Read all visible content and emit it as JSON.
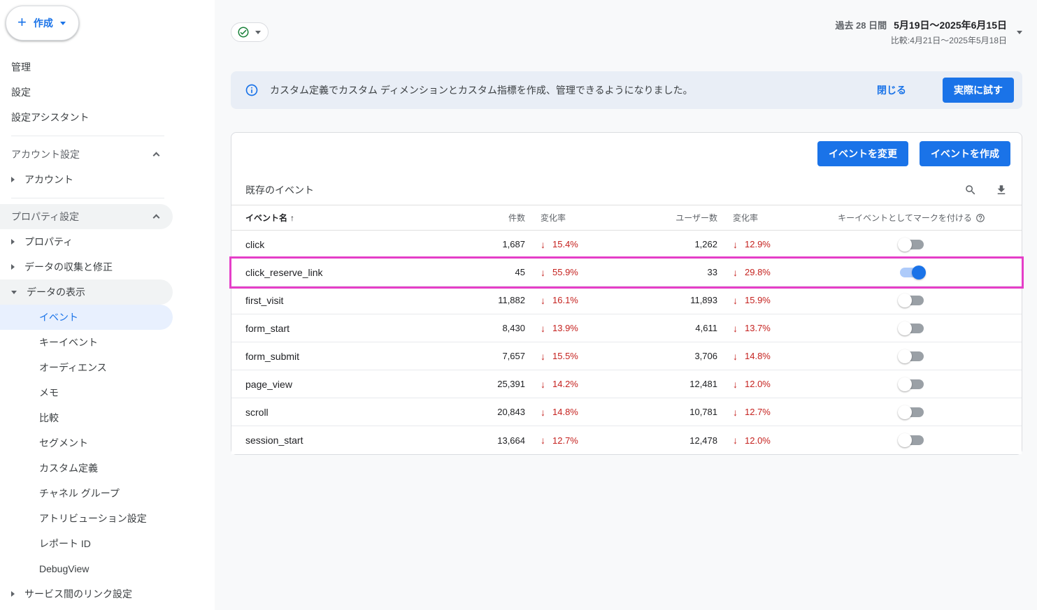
{
  "sidebar": {
    "create_button_label": "作成",
    "admin_label": "管理",
    "settings_label": "設定",
    "setup_assistant_label": "設定アシスタント",
    "account_settings_header": "アカウント設定",
    "account_label": "アカウント",
    "property_settings_header": "プロパティ設定",
    "property_label": "プロパティ",
    "data_collection_label": "データの収集と修正",
    "data_display_label": "データの表示",
    "data_display_children": [
      "イベント",
      "キーイベント",
      "オーディエンス",
      "メモ",
      "比較",
      "セグメント",
      "カスタム定義",
      "チャネル グループ",
      "アトリビューション設定",
      "レポート ID",
      "DebugView"
    ],
    "cross_service_label": "サービス間のリンク設定"
  },
  "topbar": {
    "period_label": "過去 28 日間",
    "date_range": "5月19日〜2025年6月15日",
    "comparison": "比較:4月21日〜2025年5月18日"
  },
  "banner": {
    "message": "カスタム定義でカスタム ディメンションとカスタム指標を作成、管理できるようになりました。",
    "close_label": "閉じる",
    "cta_label": "実際に試す"
  },
  "events_panel": {
    "modify_button_label": "イベントを変更",
    "create_button_label": "イベントを作成",
    "list_title": "既存のイベント",
    "columns": {
      "name": "イベント名",
      "count": "件数",
      "count_change": "変化率",
      "users": "ユーザー数",
      "users_change": "変化率",
      "key_event": "キーイベントとしてマークを付ける"
    },
    "rows": [
      {
        "name": "click",
        "count": "1,687",
        "count_change": "15.4%",
        "users": "1,262",
        "users_change": "12.9%",
        "key_event_on": false,
        "highlighted": false
      },
      {
        "name": "click_reserve_link",
        "count": "45",
        "count_change": "55.9%",
        "users": "33",
        "users_change": "29.8%",
        "key_event_on": true,
        "highlighted": true
      },
      {
        "name": "first_visit",
        "count": "11,882",
        "count_change": "16.1%",
        "users": "11,893",
        "users_change": "15.9%",
        "key_event_on": false,
        "highlighted": false
      },
      {
        "name": "form_start",
        "count": "8,430",
        "count_change": "13.9%",
        "users": "4,611",
        "users_change": "13.7%",
        "key_event_on": false,
        "highlighted": false
      },
      {
        "name": "form_submit",
        "count": "7,657",
        "count_change": "15.5%",
        "users": "3,706",
        "users_change": "14.8%",
        "key_event_on": false,
        "highlighted": false
      },
      {
        "name": "page_view",
        "count": "25,391",
        "count_change": "14.2%",
        "users": "12,481",
        "users_change": "12.0%",
        "key_event_on": false,
        "highlighted": false
      },
      {
        "name": "scroll",
        "count": "20,843",
        "count_change": "14.8%",
        "users": "10,781",
        "users_change": "12.7%",
        "key_event_on": false,
        "highlighted": false
      },
      {
        "name": "session_start",
        "count": "13,664",
        "count_change": "12.7%",
        "users": "12,478",
        "users_change": "12.0%",
        "key_event_on": false,
        "highlighted": false
      }
    ]
  },
  "colors": {
    "accent_blue": "#1a73e8",
    "negative_red": "#c5221f",
    "success_green": "#188038",
    "highlight_magenta": "#e53ec8",
    "selected_item_bg": "#e8f0fe",
    "banner_bg": "#e9eef6",
    "toggle_on_track": "#aecbfa",
    "toggle_off_track": "#9aa0a6"
  }
}
